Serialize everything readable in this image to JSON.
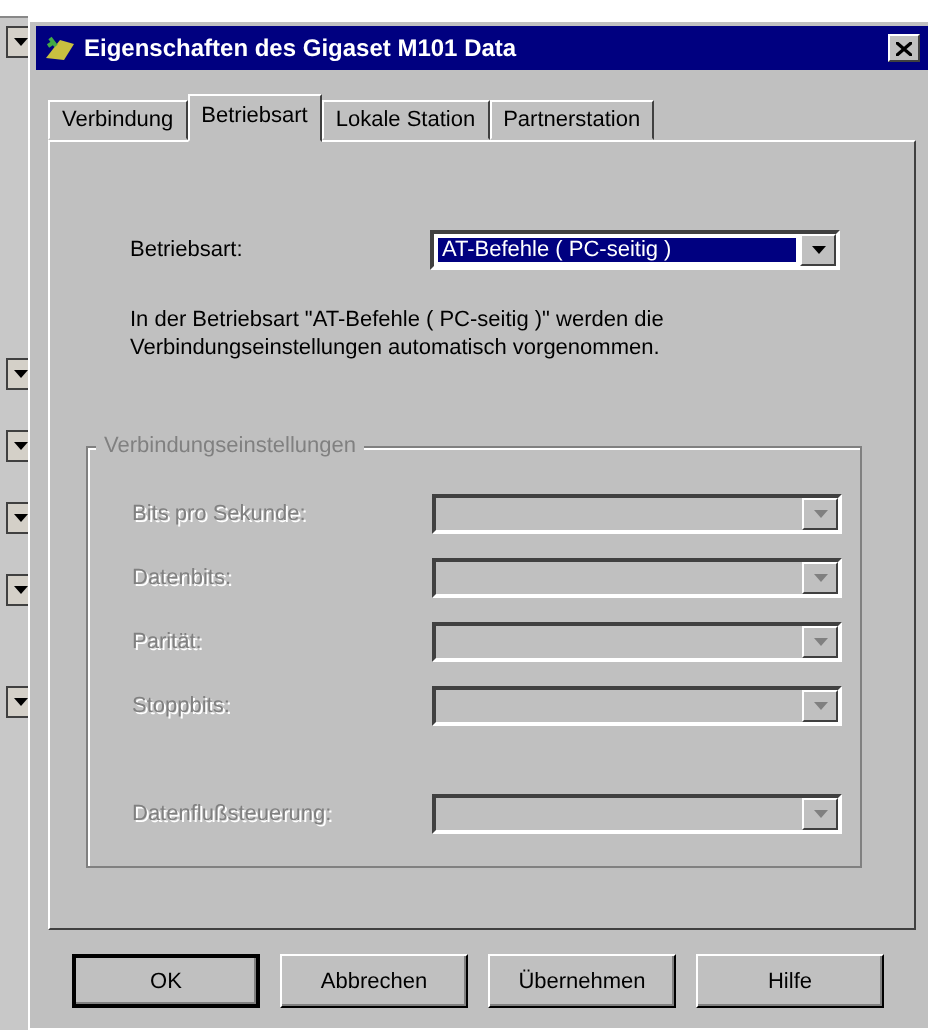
{
  "window": {
    "title": "Eigenschaften des Gigaset M101 Data"
  },
  "tabs": [
    {
      "label": "Verbindung",
      "selected": false
    },
    {
      "label": "Betriebsart",
      "selected": true
    },
    {
      "label": "Lokale Station",
      "selected": false
    },
    {
      "label": "Partnerstation",
      "selected": false
    }
  ],
  "mode": {
    "label": "Betriebsart:",
    "value": "AT-Befehle ( PC-seitig )",
    "description": "In der Betriebsart \"AT-Befehle ( PC-seitig )\" werden die Verbindungseinstellungen automatisch vorgenommen."
  },
  "group": {
    "title": "Verbindungseinstellungen",
    "disabled": true,
    "fields": [
      {
        "label": "Bits pro Sekunde:"
      },
      {
        "label": "Datenbits:"
      },
      {
        "label": "Parität:"
      },
      {
        "label": "Stoppbits:"
      },
      {
        "label": "Datenflußsteuerung:"
      }
    ]
  },
  "buttons": [
    {
      "label": "OK",
      "default": true
    },
    {
      "label": "Abbrechen",
      "default": false
    },
    {
      "label": "Übernehmen",
      "default": false
    },
    {
      "label": "Hilfe",
      "default": false
    }
  ]
}
